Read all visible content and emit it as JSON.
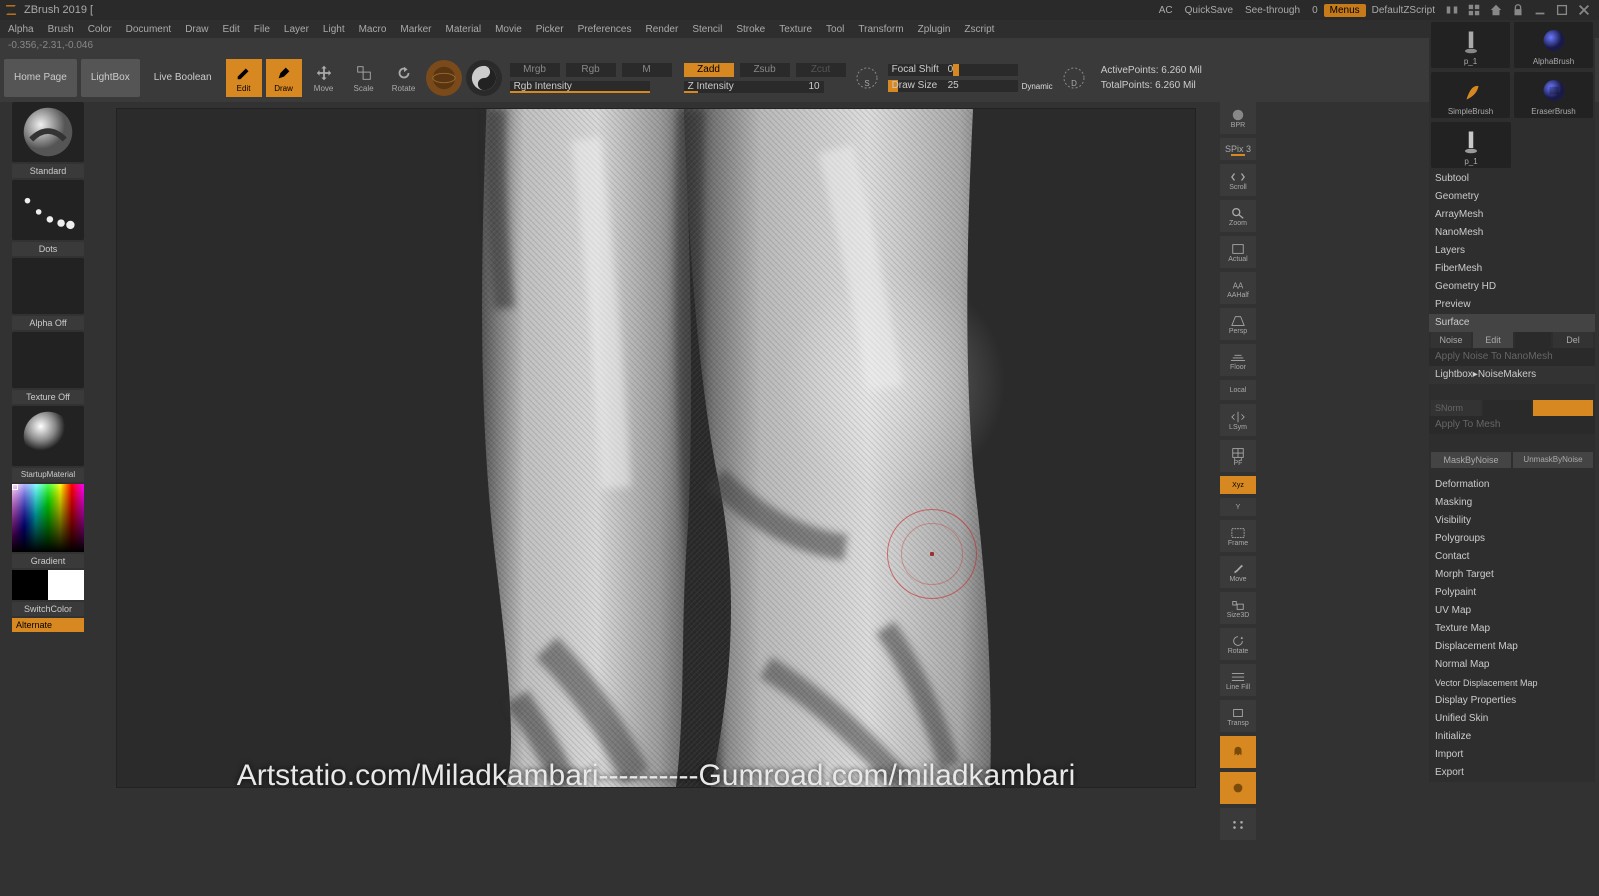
{
  "titlebar": {
    "title": "ZBrush 2019 [",
    "ac": "AC",
    "quicksave": "QuickSave",
    "seethrough": "See-through",
    "seethrough_val": "0",
    "menus": "Menus",
    "zscript": "DefaultZScript"
  },
  "menu": [
    "Alpha",
    "Brush",
    "Color",
    "Document",
    "Draw",
    "Edit",
    "File",
    "Layer",
    "Light",
    "Macro",
    "Marker",
    "Material",
    "Movie",
    "Picker",
    "Preferences",
    "Render",
    "Stencil",
    "Stroke",
    "Texture",
    "Tool",
    "Transform",
    "Zplugin",
    "Zscript"
  ],
  "status": "-0.356,-2.31,-0.046",
  "toolbar": {
    "home": "Home Page",
    "lightbox": "LightBox",
    "liveboolean": "Live Boolean",
    "edit": "Edit",
    "draw": "Draw",
    "move": "Move",
    "scale": "Scale",
    "rotate": "Rotate",
    "mrgb": "Mrgb",
    "rgb": "Rgb",
    "m": "M",
    "rgb_label": "Rgb Intensity",
    "zadd": "Zadd",
    "zsub": "Zsub",
    "zcut": "Zcut",
    "z_label": "Z Intensity",
    "z_val": "10",
    "focal_label": "Focal Shift",
    "focal_val": "0",
    "draw_label": "Draw Size",
    "draw_val": "25",
    "dynamic": "Dynamic",
    "active": "ActivePoints: 6.260 Mil",
    "total": "TotalPoints: 6.260 Mil"
  },
  "left": {
    "brush": "Standard",
    "stroke": "Dots",
    "alpha": "Alpha Off",
    "texture": "Texture Off",
    "material": "StartupMaterial",
    "gradient": "Gradient",
    "switch": "SwitchColor",
    "alternate": "Alternate"
  },
  "shelf": {
    "bpr": "BPR",
    "spix": "SPix 3",
    "scroll": "Scroll",
    "zoom": "Zoom",
    "actual": "Actual",
    "aahalf": "AAHalf",
    "persp": "Persp",
    "floor": "Floor",
    "local": "Local",
    "lsym": "LSym",
    "pf": "PF",
    "xyz": "Xyz",
    "y": "Y",
    "frame": "Frame",
    "move": "Move",
    "threed": "Size3D",
    "rotate": "Rotate",
    "linefill": "Line Fill",
    "transp": "Transp",
    "ghost": "Ghost",
    "solo": "Solo",
    "xpose": "Xpose"
  },
  "right": {
    "thumb1": "p_1",
    "alpha": "AlphaBrush",
    "simple": "SimpleBrush",
    "eraser": "EraserBrush",
    "thumb2": "p_1",
    "sections": [
      "Subtool",
      "Geometry",
      "ArrayMesh",
      "NanoMesh",
      "Layers",
      "FiberMesh",
      "Geometry HD",
      "Preview",
      "Surface"
    ],
    "noise": "Noise",
    "edit": "Edit",
    "del": "Del",
    "applynano": "Apply Noise To NanoMesh",
    "lbnm": "Lightbox▸NoiseMakers",
    "snorm": "SNorm",
    "applymesh": "Apply To Mesh",
    "maskby": "MaskByNoise",
    "unmaskby": "UnmaskByNoise",
    "sections2": [
      "Deformation",
      "Masking",
      "Visibility",
      "Polygroups",
      "Contact",
      "Morph Target",
      "Polypaint",
      "UV Map",
      "Texture Map",
      "Displacement Map",
      "Normal Map",
      "Vector Displacement Map",
      "Display Properties",
      "Unified Skin",
      "Initialize",
      "Import",
      "Export"
    ]
  },
  "watermark": "Artstatio.com/Miladkambari----------Gumroad.com/miladkambari"
}
